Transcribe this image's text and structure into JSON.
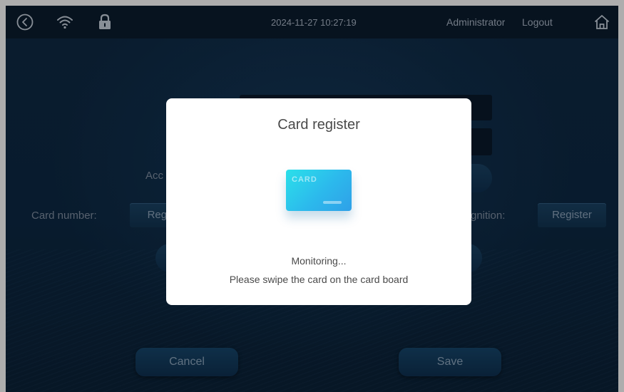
{
  "topbar": {
    "datetime": "2024-11-27 10:27:19",
    "user": "Administrator",
    "logout_label": "Logout",
    "icons": [
      "back-icon",
      "wifi-icon",
      "lock-icon",
      "home-icon"
    ]
  },
  "form": {
    "partial_label_account": "Acc",
    "card_number_label": "Card number:",
    "card_register_label": "Regi",
    "recognition_label": "gnition:",
    "recognition_register_label": "Register",
    "cancel_label": "Cancel",
    "save_label": "Save"
  },
  "dialog": {
    "title": "Card register",
    "card_image_text": "CARD",
    "status": "Monitoring...",
    "instruction": "Please swipe the card on the card board"
  },
  "colors": {
    "background": "#0d2944",
    "topbar": "#0b1c2e",
    "dialog": "#ffffff",
    "card_accent": "#2cb9ec"
  }
}
